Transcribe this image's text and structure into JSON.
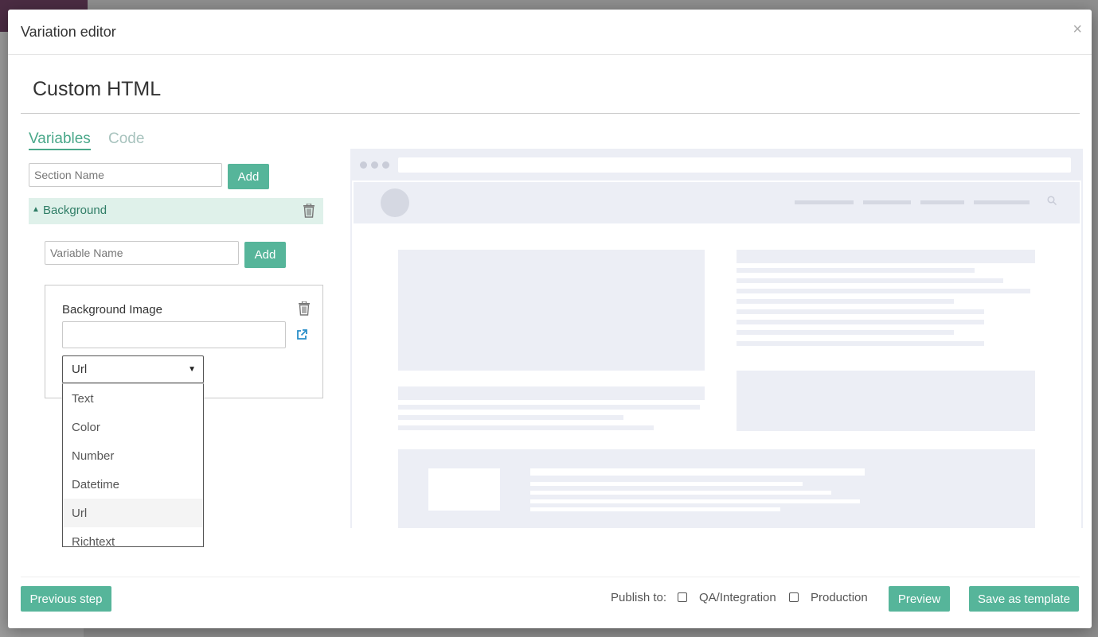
{
  "modal": {
    "title": "Variation editor",
    "close_glyph": "×"
  },
  "page": {
    "title": "Custom HTML"
  },
  "tabs": [
    {
      "label": "Variables",
      "active": true
    },
    {
      "label": "Code",
      "active": false
    }
  ],
  "section_form": {
    "placeholder": "Section Name",
    "add_label": "Add"
  },
  "section": {
    "name": "Background",
    "caret_glyph": "▲",
    "variable_form": {
      "placeholder": "Variable Name",
      "add_label": "Add"
    },
    "variable": {
      "label": "Background Image",
      "value": "",
      "type_select": {
        "selected": "Url",
        "arrow_glyph": "▼",
        "options": [
          "Text",
          "Color",
          "Number",
          "Datetime",
          "Url",
          "Richtext"
        ]
      }
    }
  },
  "footer": {
    "previous_label": "Previous step",
    "publish_label": "Publish to:",
    "targets": [
      {
        "label": "QA/Integration",
        "checked": false
      },
      {
        "label": "Production",
        "checked": false
      }
    ],
    "preview_label": "Preview",
    "save_template_label": "Save as template"
  },
  "colors": {
    "accent": "#56b59a",
    "accent_text": "#4aa88a",
    "section_bg": "#dff1ea",
    "preview_placeholder": "#eceef5",
    "header_purple": "#4b2c43"
  }
}
